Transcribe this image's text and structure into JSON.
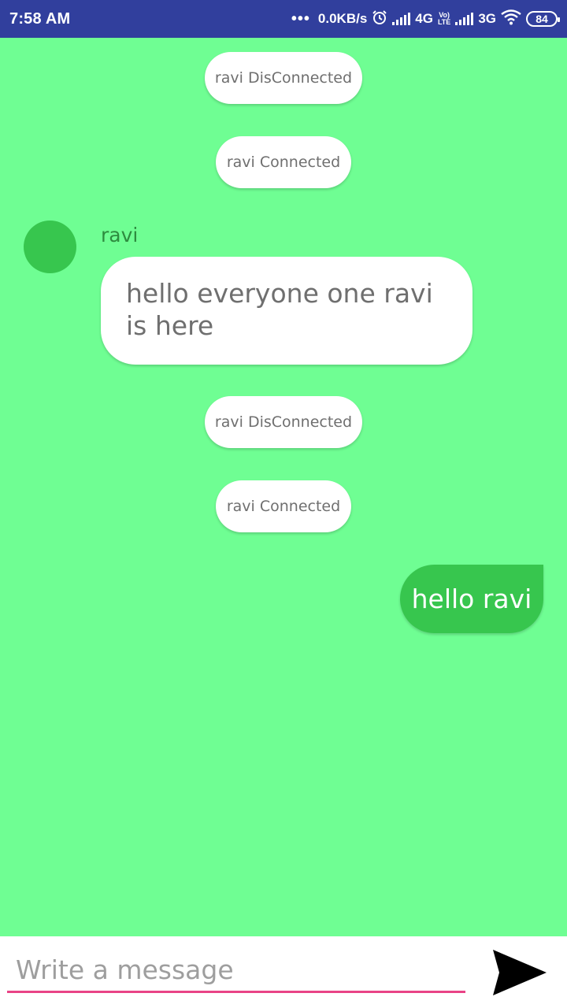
{
  "status_bar": {
    "time": "7:58 AM",
    "dots": "•••",
    "data_rate": "0.0KB/s",
    "alarm_icon": "alarm-icon",
    "network1": "4G",
    "volte_top": "Vo)",
    "volte_bottom": "LTE",
    "network2": "3G",
    "wifi_icon": "wifi-icon",
    "battery": "84"
  },
  "chat": {
    "background_color": "#6ffe93",
    "events": [
      {
        "text": "ravi DisConnected"
      },
      {
        "text": "ravi Connected"
      },
      {
        "text": "ravi DisConnected"
      },
      {
        "text": "ravi Connected"
      }
    ],
    "incoming": {
      "sender": "ravi",
      "text": "hello everyone one ravi is here",
      "avatar_color": "#37c64e"
    },
    "outgoing": {
      "text": "hello ravi",
      "bubble_color": "#37c64e"
    }
  },
  "composer": {
    "placeholder": "Write a message",
    "value": "",
    "underline_color": "#e94386",
    "send_icon": "send-icon"
  },
  "colors": {
    "status_bar": "#313f9d",
    "accent_green": "#37c64e"
  }
}
